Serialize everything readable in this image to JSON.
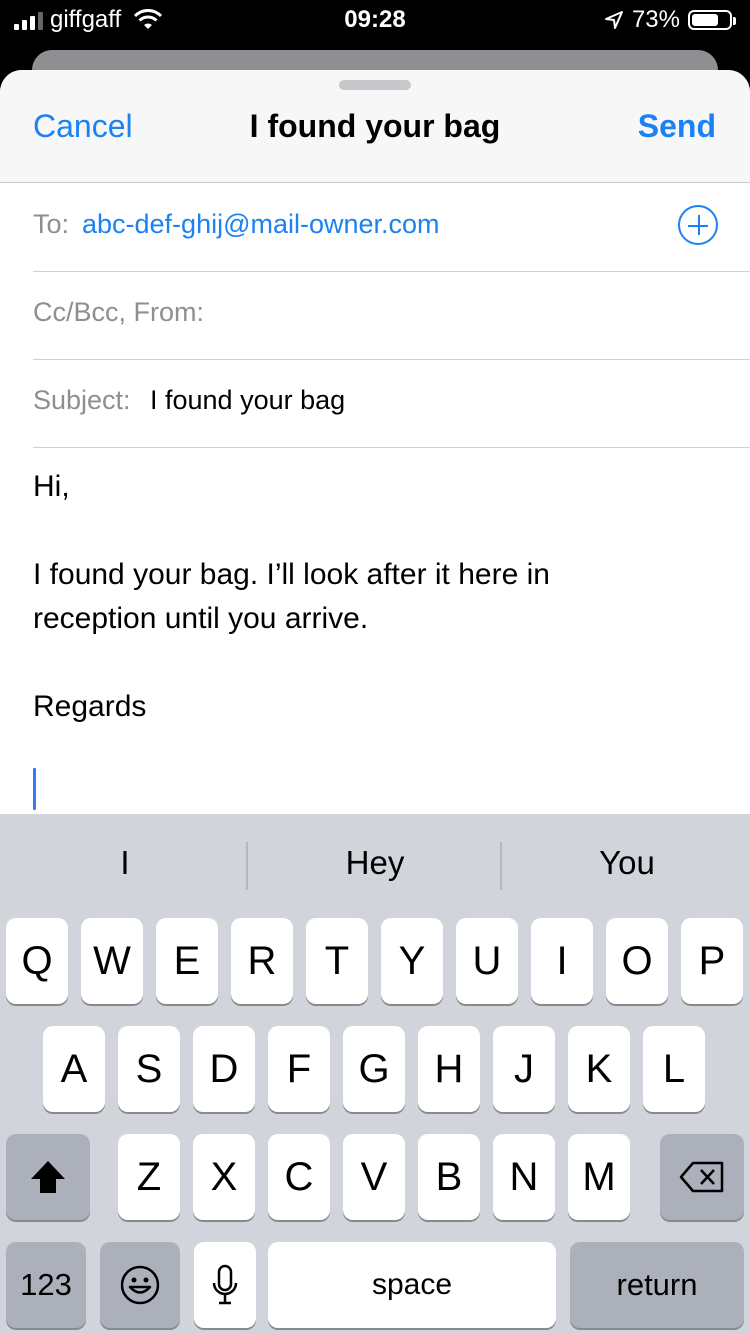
{
  "status_bar": {
    "carrier": "giffgaff",
    "time": "09:28",
    "battery_percent": "73%",
    "battery_level": 0.73,
    "signal_bars": 3
  },
  "nav": {
    "cancel_label": "Cancel",
    "title": "I found your bag",
    "send_label": "Send"
  },
  "fields": {
    "to_label": "To:",
    "to_value": "abc-def-ghij@mail-owner.com",
    "cc_label": "Cc/Bcc, From:",
    "subject_label": "Subject:",
    "subject_value": "I found your bag"
  },
  "body": {
    "greeting": "Hi,",
    "line1": "I found your bag. I’ll look after it here in",
    "line2": "reception until you arrive.",
    "signoff": "Regards"
  },
  "predictions": [
    "I",
    "Hey",
    "You"
  ],
  "keyboard": {
    "row1": [
      "Q",
      "W",
      "E",
      "R",
      "T",
      "Y",
      "U",
      "I",
      "O",
      "P"
    ],
    "row2": [
      "A",
      "S",
      "D",
      "F",
      "G",
      "H",
      "J",
      "K",
      "L"
    ],
    "row3": [
      "Z",
      "X",
      "C",
      "V",
      "B",
      "N",
      "M"
    ],
    "numbers_label": "123",
    "space_label": "space",
    "return_label": "return"
  },
  "colors": {
    "accent": "#1a82f3",
    "cursor": "#3478f6",
    "keyboard_bg": "#d1d4da",
    "dark_key": "#abb0bb"
  }
}
